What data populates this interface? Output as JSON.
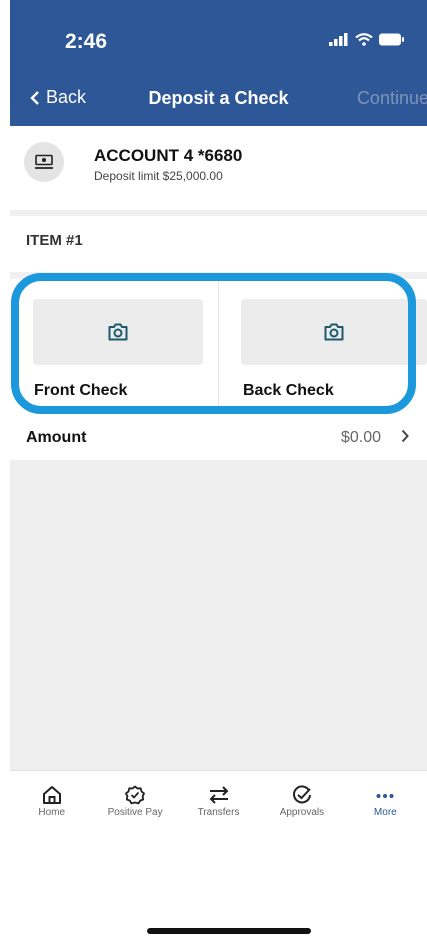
{
  "status_bar": {
    "time": "2:46"
  },
  "nav": {
    "back_label": "Back",
    "title": "Deposit a Check",
    "continue_label": "Continue"
  },
  "account": {
    "name": "ACCOUNT 4 *6680",
    "limit": "Deposit limit $25,000.00"
  },
  "item": {
    "label": "ITEM #1"
  },
  "checks": {
    "front_label": "Front Check",
    "back_label": "Back Check"
  },
  "amount": {
    "label": "Amount",
    "value": "$0.00"
  },
  "tabbar": {
    "items": [
      {
        "label": "Home",
        "icon": "home-icon"
      },
      {
        "label": "Positive Pay",
        "icon": "badge-check-icon"
      },
      {
        "label": "Transfers",
        "icon": "transfer-arrows-icon"
      },
      {
        "label": "Approvals",
        "icon": "check-circle-icon"
      },
      {
        "label": "More",
        "icon": "more-dots-icon"
      }
    ],
    "active": "More"
  },
  "colors": {
    "header": "#2d5796",
    "highlight": "#1b99dc",
    "icon_teal": "#1e5a6e"
  }
}
